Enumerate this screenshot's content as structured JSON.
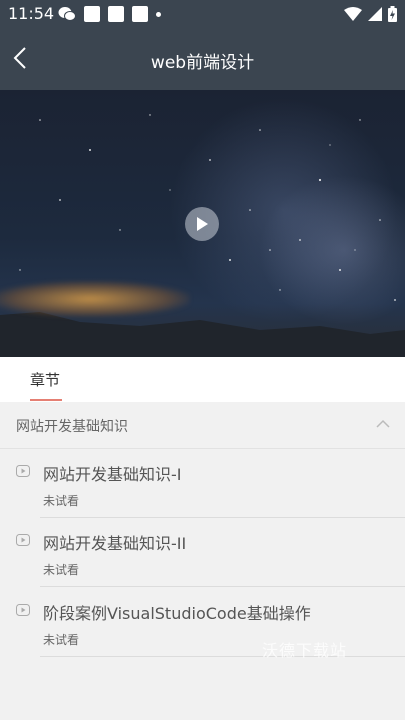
{
  "status_bar": {
    "time": "11:54"
  },
  "header": {
    "title": "web前端设计"
  },
  "tabs": [
    {
      "label": "章节",
      "active": true
    }
  ],
  "section": {
    "title": "网站开发基础知识"
  },
  "lessons": [
    {
      "title": "网站开发基础知识-I",
      "status": "未试看"
    },
    {
      "title": "网站开发基础知识-II",
      "status": "未试看"
    },
    {
      "title": "阶段案例VisualStudioCode基础操作",
      "status": "未试看"
    }
  ],
  "watermark": "沃德下载站",
  "colors": {
    "header_bg": "#3b4550",
    "tab_accent": "#e57f73",
    "list_bg": "#f1f1f1"
  }
}
